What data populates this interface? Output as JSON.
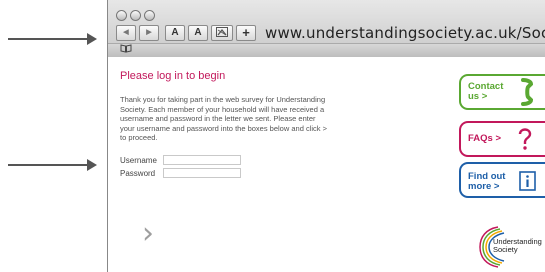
{
  "browser": {
    "url": "www.understandingsociety.ac.uk/Society",
    "buttons": {
      "back": "◀",
      "forward": "▶",
      "text_smaller": "A",
      "text_larger": "A",
      "add_bookmark": "+"
    },
    "icons": [
      "traffic-light-icon",
      "back-icon",
      "forward-icon",
      "snapback-icon",
      "bookmarks-book-icon"
    ]
  },
  "page": {
    "title": "Please log in to begin",
    "intro": "Thank you for taking part in the web survey for Understanding Society. Each member of your household will have received a username and password in the letter we sent. Please enter your username and password into the boxes below and click > to proceed.",
    "form": {
      "username_label": "Username",
      "password_label": "Password",
      "username_value": "",
      "password_value": ""
    },
    "next_label": "›",
    "side_links": [
      {
        "line1": "Contact",
        "line2": "us >",
        "icon": "phone-icon",
        "color": "#5aa832"
      },
      {
        "line1": "FAQs >",
        "line2": "",
        "icon": "question-icon",
        "color": "#c2185b"
      },
      {
        "line1": "Find out",
        "line2": "more >",
        "icon": "info-icon",
        "color": "#1e5fa8"
      }
    ],
    "logo": {
      "line1": "Understanding",
      "line2": "Society"
    }
  },
  "colors": {
    "accent": "#c2185b",
    "contact": "#5aa832",
    "info": "#1e5fa8"
  }
}
